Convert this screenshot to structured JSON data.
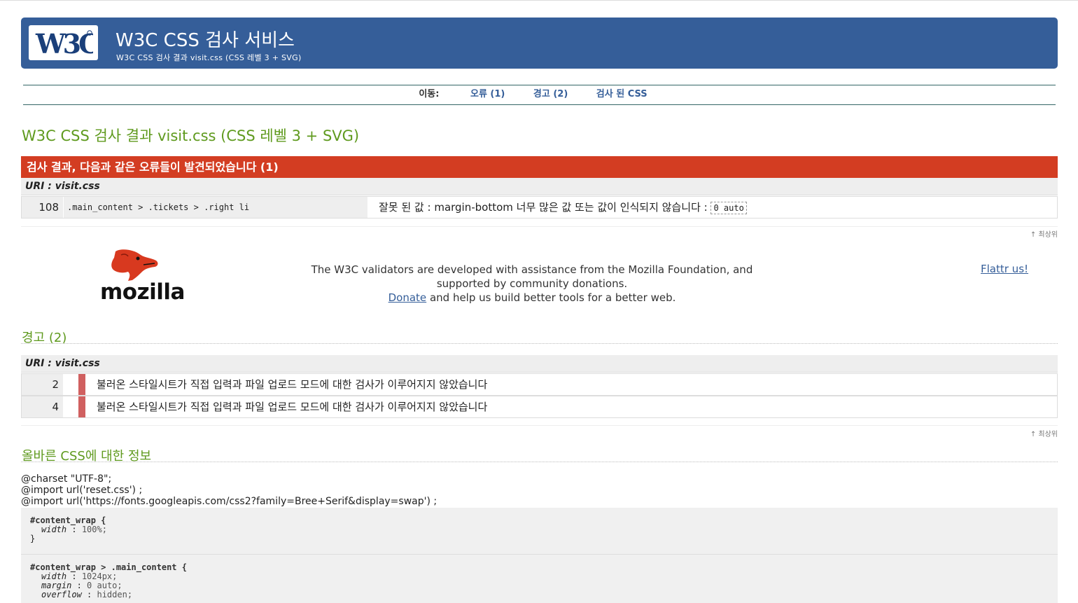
{
  "header": {
    "logo_text": "W3C",
    "title": "W3C CSS 검사 서비스",
    "subtitle": "W3C CSS 검사 결과 visit.css (CSS 레벨 3 + SVG)"
  },
  "nav": {
    "label": "이동:",
    "links": [
      "오류 (1)",
      "경고 (2)",
      "검사 된 CSS"
    ]
  },
  "main_title": "W3C CSS 검사 결과 visit.css (CSS 레벨 3 + SVG)",
  "errors": {
    "header": "검사 결과, 다음과 같은 오류들이 발견되었습니다 (1)",
    "uri": "URI : visit.css",
    "rows": [
      {
        "line": "108",
        "context": ".main_content > .tickets > .right li",
        "message": "잘못 된 값 : margin-bottom 너무 많은 값 또는 값이 인식되지 않습니다 :",
        "value": "0 auto"
      }
    ]
  },
  "to_top": "↑ 최상위",
  "support": {
    "logo_word": "mozilla",
    "line1": "The W3C validators are developed with assistance from the Mozilla Foundation, and supported by community donations.",
    "donate": "Donate",
    "line2": "and help us build better tools for a better web.",
    "flattr": "Flattr us!"
  },
  "warnings": {
    "title": "경고 (2)",
    "uri": "URI : visit.css",
    "rows": [
      {
        "line": "2",
        "message": "불러온 스타일시트가 직접 입력과 파일 업로드 모드에 대한 검사가 이루어지지 않았습니다"
      },
      {
        "line": "4",
        "message": "불러온 스타일시트가 직접 입력과 파일 업로드 모드에 대한 검사가 이루어지지 않았습니다"
      }
    ]
  },
  "valid_css": {
    "title": "올바른 CSS에 대한 정보",
    "imports": [
      "@charset \"UTF-8\";",
      "@import url('reset.css') ;",
      "@import url('https://fonts.googleapis.com/css2?family=Bree+Serif&display=swap') ;"
    ],
    "rules": [
      {
        "selector": "#content_wrap {",
        "props": [
          {
            "name": "width",
            "value": "100%;"
          }
        ],
        "close": "}"
      },
      {
        "selector": "#content_wrap > .main_content {",
        "props": [
          {
            "name": "width",
            "value": "1024px;"
          },
          {
            "name": "margin",
            "value": "0 auto;"
          },
          {
            "name": "overflow",
            "value": "hidden;"
          }
        ]
      }
    ]
  },
  "colors": {
    "banner": "#355e99",
    "error_header": "#d33d22",
    "section_title": "#5f9a1e",
    "warning_bar": "#d06060"
  }
}
